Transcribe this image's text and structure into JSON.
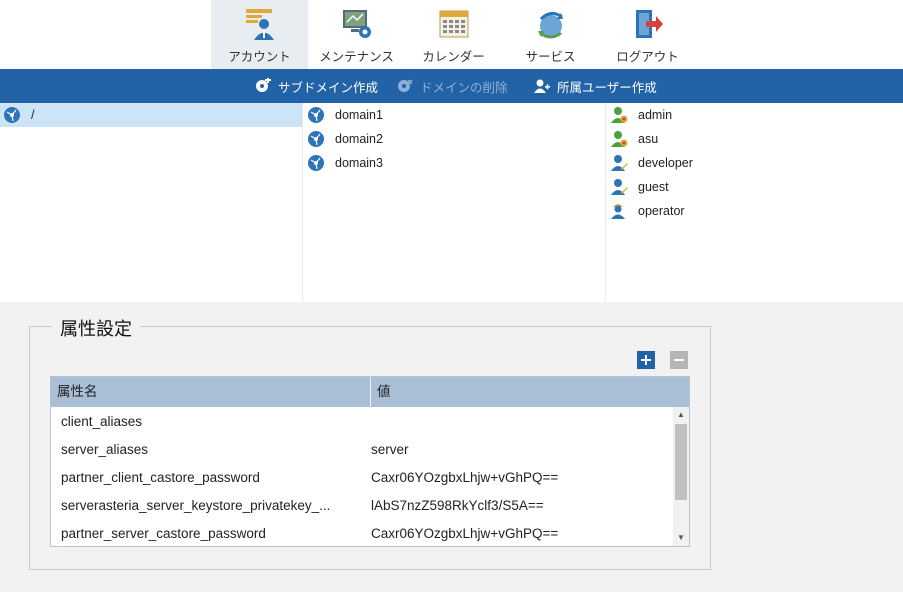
{
  "nav": {
    "items": [
      {
        "label": "アカウント",
        "icon": "account-icon"
      },
      {
        "label": "メンテナンス",
        "icon": "maintenance-icon"
      },
      {
        "label": "カレンダー",
        "icon": "calendar-icon"
      },
      {
        "label": "サービス",
        "icon": "service-icon"
      },
      {
        "label": "ログアウト",
        "icon": "logout-icon"
      }
    ],
    "active_index": 0
  },
  "toolbar": {
    "create_subdomain": "サブドメイン作成",
    "delete_domain": "ドメインの削除",
    "create_user": "所属ユーザー作成"
  },
  "domain_tree": {
    "root": "/"
  },
  "domains": [
    "domain1",
    "domain2",
    "domain3"
  ],
  "users": [
    {
      "name": "admin",
      "role": "admin"
    },
    {
      "name": "asu",
      "role": "admin"
    },
    {
      "name": "developer",
      "role": "developer"
    },
    {
      "name": "guest",
      "role": "developer"
    },
    {
      "name": "operator",
      "role": "operator"
    }
  ],
  "attributes": {
    "title": "属性設定",
    "columns": [
      "属性名",
      "値"
    ],
    "rows": [
      {
        "name": "client_aliases",
        "value": ""
      },
      {
        "name": "server_aliases",
        "value": "server"
      },
      {
        "name": "partner_client_castore_password",
        "value": "Caxr06YOzgbxLhjw+vGhPQ=="
      },
      {
        "name": "serverasteria_server_keystore_privatekey_...",
        "value": "lAbS7nzZ598RkYclf3/S5A=="
      },
      {
        "name": "partner_server_castore_password",
        "value": "Caxr06YOzgbxLhjw+vGhPQ=="
      }
    ]
  },
  "colors": {
    "toolbar": "#2163a6",
    "header": "#a9bfd6",
    "selected": "#cce3f8"
  }
}
